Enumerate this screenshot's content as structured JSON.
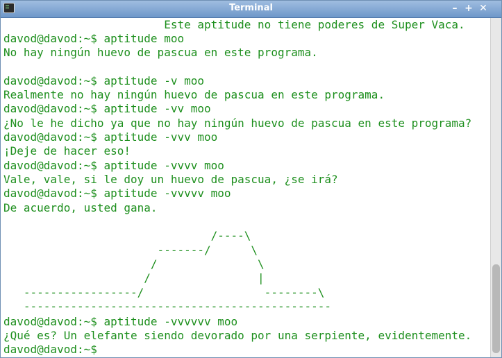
{
  "window": {
    "title": "Terminal",
    "icon": "terminal-icon",
    "minimize_icon": "minimize-icon",
    "maximize_icon": "maximize-icon",
    "close_icon": "close-icon"
  },
  "terminal": {
    "text_color": "#1d8f1d",
    "background": "#ffffff",
    "lines": [
      "                        Este aptitude no tiene poderes de Super Vaca.",
      "davod@davod:~$ aptitude moo",
      "No hay ningún huevo de pascua en este programa.",
      "",
      "davod@davod:~$ aptitude -v moo",
      "Realmente no hay ningún huevo de pascua en este programa.",
      "davod@davod:~$ aptitude -vv moo",
      "¿No le he dicho ya que no hay ningún huevo de pascua en este programa?",
      "davod@davod:~$ aptitude -vvv moo",
      "¡Deje de hacer eso!",
      "davod@davod:~$ aptitude -vvvv moo",
      "Vale, vale, si le doy un huevo de pascua, ¿se irá?",
      "davod@davod:~$ aptitude -vvvvv moo",
      "De acuerdo, usted gana.",
      "",
      "                               /----\\",
      "                       -------/      \\",
      "                      /               \\",
      "                     /                |",
      "   -----------------/                  --------\\",
      "   ----------------------------------------------",
      "davod@davod:~$ aptitude -vvvvvv moo",
      "¿Qué es? Un elefante siendo devorado por una serpiente, evidentemente.",
      "davod@davod:~$ "
    ]
  }
}
